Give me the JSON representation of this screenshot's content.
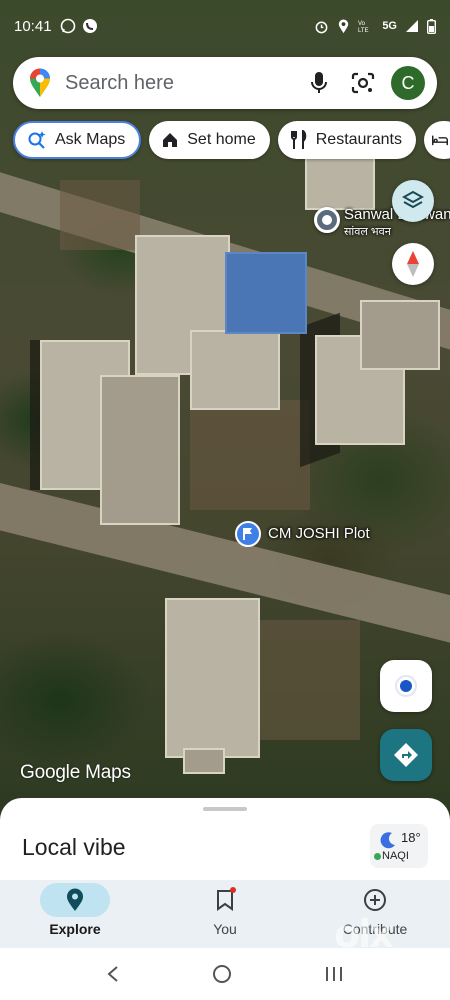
{
  "status_bar": {
    "time": "10:41",
    "right_text": "5G"
  },
  "search": {
    "placeholder": "Search here",
    "avatar_initial": "C"
  },
  "chips": [
    {
      "label": "Ask Maps",
      "icon": "ask-maps-icon"
    },
    {
      "label": "Set home",
      "icon": "home-icon"
    },
    {
      "label": "Restaurants",
      "icon": "fork-knife-icon"
    }
  ],
  "map": {
    "place1_name": "Sanwal Bhawan",
    "place1_local": "सांवल भवन",
    "plot_name": "CM JOSHI Plot",
    "logo": "Google Maps"
  },
  "sheet": {
    "title": "Local vibe",
    "temperature": "18°",
    "aqi": "NAQI"
  },
  "nav": [
    {
      "label": "Explore",
      "icon": "explore-pin-icon",
      "active": true
    },
    {
      "label": "You",
      "icon": "bookmark-icon",
      "active": false
    },
    {
      "label": "Contribute",
      "icon": "plus-circle-icon",
      "active": false
    }
  ],
  "watermark": "olx",
  "colors": {
    "accent": "#4a7fe0",
    "nav_active_pill": "#bfe3f0",
    "directions_button": "#1c7580",
    "avatar": "#2e6b2b"
  }
}
